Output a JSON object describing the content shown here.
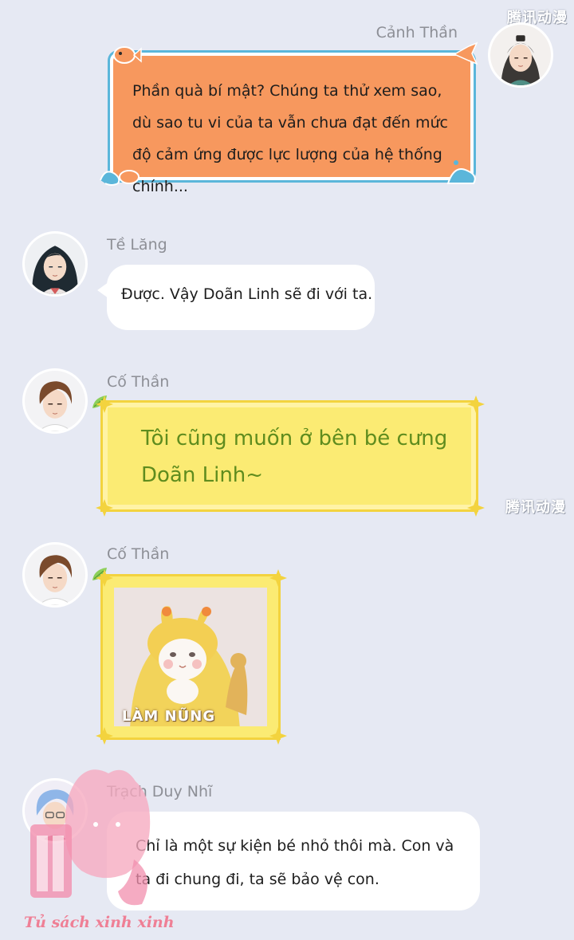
{
  "watermark": "腾讯动漫",
  "messages": [
    {
      "sender": "Cảnh Thần",
      "avatar": "long-haired-man-avatar",
      "text": "Phần quà bí mật? Chúng ta thử xem sao, dù sao tu vi của ta vẫn chưa đạt đến mức độ cảm ứng được lực lượng của hệ thống chính...",
      "style": "orange-fish-bubble",
      "align": "right"
    },
    {
      "sender": "Tề Lăng",
      "avatar": "dark-haired-woman-avatar",
      "text": "Được. Vậy Doãn Linh sẽ đi với ta.",
      "style": "white-bubble",
      "align": "left"
    },
    {
      "sender": "Cố Thần",
      "avatar": "brown-haired-man-avatar",
      "text": "Tôi cũng muốn ở bên bé cưng Doãn Linh~",
      "style": "yellow-bubble",
      "align": "left"
    },
    {
      "sender": "Cố Thần",
      "avatar": "brown-haired-man-avatar",
      "sticker_label": "LÀM NŨNG",
      "sticker": "cat-in-yellow-costume-image",
      "style": "yellow-sticker-frame",
      "align": "left"
    },
    {
      "sender": "Trạch Duy Nhĩ",
      "avatar": "blue-haired-man-glasses-avatar",
      "text": "Chỉ là một sự kiện bé nhỏ thôi mà. Con và ta đi chung đi, ta sẽ bảo vệ con.",
      "style": "white-bubble",
      "align": "left"
    }
  ],
  "brand": "Tủ sách xinh xinh",
  "colors": {
    "background": "#e6e9f3",
    "orange": "#f7985e",
    "yellow": "#fbeb73",
    "yellow_text": "#5f8c1e",
    "pink": "#ef7f95"
  }
}
